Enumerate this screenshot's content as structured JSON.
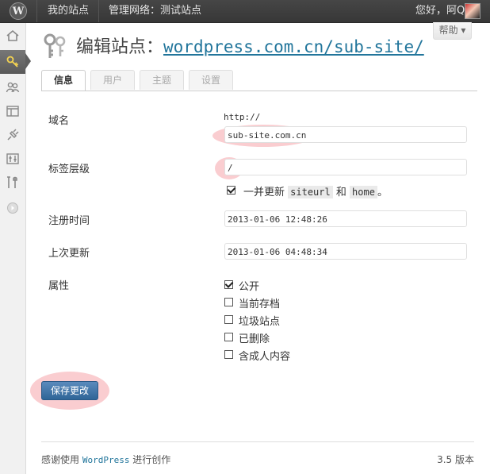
{
  "adminbar": {
    "logo": "wordpress-logo",
    "my_sites": "我的站点",
    "network": "管理网络：测试站点",
    "greeting": "您好，阿Q"
  },
  "menu": {
    "items": [
      "home-icon",
      "sites-icon",
      "users-icon",
      "themes-icon",
      "plugins-icon",
      "settings-icon",
      "tools-icon",
      "collapse-icon"
    ],
    "current": "sites-icon"
  },
  "help_label": "帮助 ▾",
  "page": {
    "heading_prefix": "编辑站点：",
    "heading_link": "wordpress.com.cn/sub-site/"
  },
  "tabs": [
    {
      "label": "信息",
      "active": true
    },
    {
      "label": "用户",
      "active": false
    },
    {
      "label": "主题",
      "active": false
    },
    {
      "label": "设置",
      "active": false
    }
  ],
  "form": {
    "domain_label": "域名",
    "domain_prefix": "http://",
    "domain_value": "sub-site.com.cn",
    "path_label": "标签层级",
    "path_value": "/",
    "update_prefix": "一并更新",
    "update_code1": "siteurl",
    "update_and": "和",
    "update_code2": "home",
    "update_suffix": "。",
    "registered_label": "注册时间",
    "registered_value": "2013-01-06 12:48:26",
    "updated_label": "上次更新",
    "updated_value": "2013-01-06 04:48:34",
    "attributes_label": "属性",
    "attributes": [
      {
        "label": "公开",
        "checked": true
      },
      {
        "label": "当前存档",
        "checked": false
      },
      {
        "label": "垃圾站点",
        "checked": false
      },
      {
        "label": "已删除",
        "checked": false
      },
      {
        "label": "含成人内容",
        "checked": false
      }
    ]
  },
  "save_label": "保存更改",
  "footer": {
    "thanks_prefix": "感谢使用",
    "thanks_link": "WordPress",
    "thanks_suffix": "进行创作",
    "version": "3.5 版本"
  },
  "colors": {
    "link": "#21759b",
    "button": "#2f6597",
    "highlight": "#f6a4aa"
  }
}
